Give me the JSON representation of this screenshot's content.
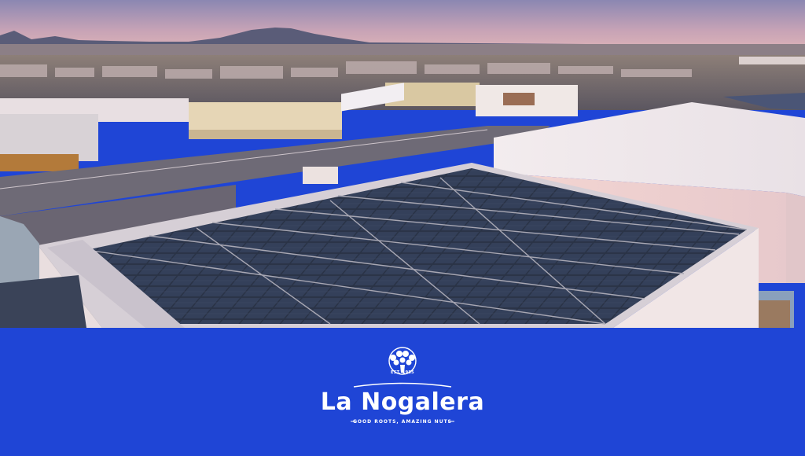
{
  "photo": {
    "description_icon": "solar-rooftop-photo"
  },
  "brand": {
    "name": "La Nogalera",
    "established": "EST. 1985",
    "tagline": "GOOD ROOTS, AMAZING NUTS",
    "logo_icon": "tree-icon"
  },
  "colors": {
    "banner": "#1f45d6",
    "text": "#ffffff"
  }
}
